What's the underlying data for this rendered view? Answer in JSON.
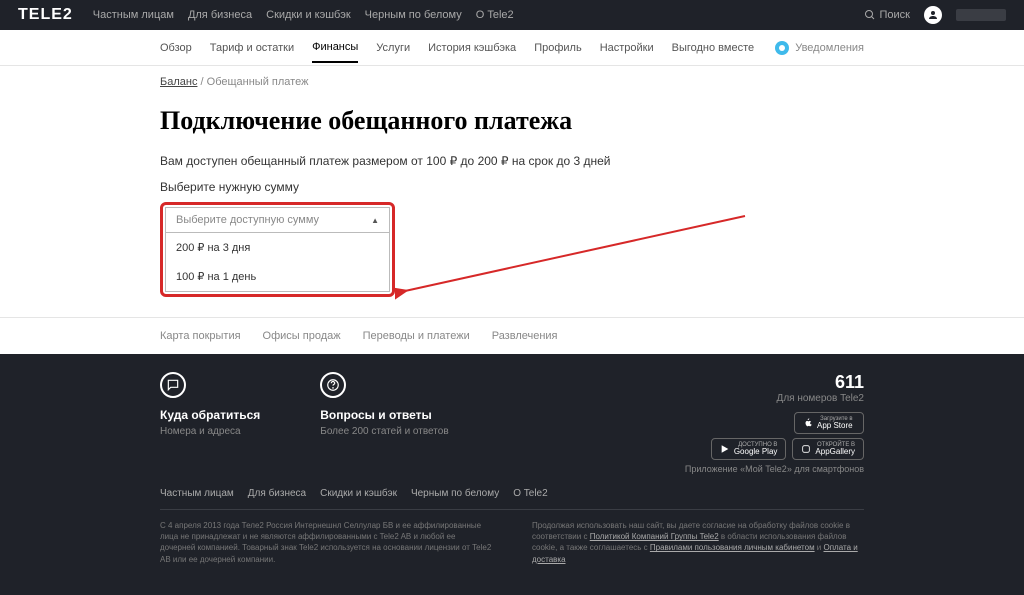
{
  "header": {
    "logo": "TELE2",
    "topnav": [
      "Частным лицам",
      "Для бизнеса",
      "Скидки и кэшбэк",
      "Черным по белому",
      "О Tele2"
    ],
    "search": "Поиск"
  },
  "subnav": {
    "items": [
      "Обзор",
      "Тариф и остатки",
      "Финансы",
      "Услуги",
      "История кэшбэка",
      "Профиль",
      "Настройки",
      "Выгодно вместе"
    ],
    "notif": "Уведомления"
  },
  "breadcrumb": {
    "link": "Баланс",
    "current": "Обещанный платеж"
  },
  "page": {
    "title": "Подключение обещанного платежа",
    "desc": "Вам доступен обещанный платеж размером от 100 ₽ до 200 ₽ на срок до 3 дней",
    "label": "Выберите нужную сумму",
    "select_placeholder": "Выберите доступную сумму",
    "options": [
      "200 ₽ на 3 дня",
      "100 ₽ на 1 день"
    ]
  },
  "footer_links": [
    "Карта покрытия",
    "Офисы продаж",
    "Переводы и платежи",
    "Развлечения"
  ],
  "footer": {
    "contact": {
      "title": "Куда обратиться",
      "sub": "Номера и адреса"
    },
    "faq": {
      "title": "Вопросы и ответы",
      "sub": "Более 200 статей и ответов"
    },
    "hotline": "611",
    "hotline_sub": "Для номеров Tele2",
    "badges": {
      "appstore": {
        "small": "Загрузите в",
        "big": "App Store"
      },
      "google": {
        "small": "ДОСТУПНО В",
        "big": "Google Play"
      },
      "huawei": {
        "small": "ОТКРОЙТЕ В",
        "big": "AppGallery"
      }
    },
    "app_sub": "Приложение «Мой Tele2» для смартфонов",
    "nav2": [
      "Частным лицам",
      "Для бизнеса",
      "Скидки и кэшбэк",
      "Черным по белому",
      "О Tele2"
    ],
    "legal1": "С 4 апреля 2013 года Теле2 Россия Интернешнл Селлулар БВ и ее аффилированные лица не принадлежат и не являются аффилированными с Tele2 AB и любой ее дочерней компанией. Товарный знак Tele2 используется на основании лицензии от Tele2 AB или ее дочерней компании.",
    "legal2_a": "Продолжая использовать наш сайт, вы даете согласие на обработку файлов cookie в соответствии с ",
    "legal2_link1": "Политикой Компаний Группы Tele2",
    "legal2_b": " в области использования файлов cookie, а также соглашаетесь с ",
    "legal2_link2": "Правилами пользования личным кабинетом",
    "legal2_c": " и ",
    "legal2_link3": "Оплата и доставка"
  }
}
